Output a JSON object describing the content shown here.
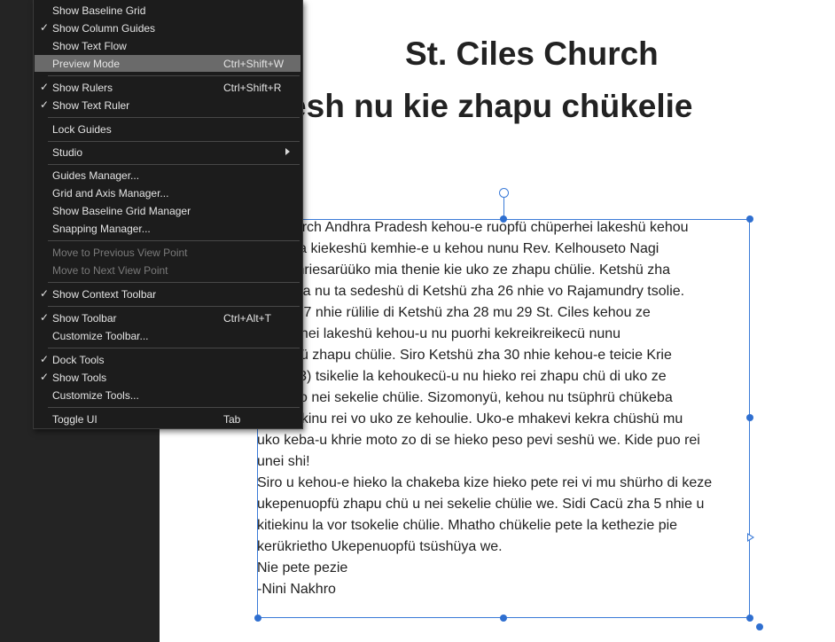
{
  "menu": {
    "items": [
      {
        "label": "Show Baseline Grid",
        "check": "",
        "shortcut": ""
      },
      {
        "label": "Show Column Guides",
        "check": "✓",
        "shortcut": ""
      },
      {
        "label": "Show Text Flow",
        "check": "",
        "shortcut": ""
      },
      {
        "label": "Preview Mode",
        "check": "",
        "shortcut": "Ctrl+Shift+W"
      },
      {
        "label": "Show Rulers",
        "check": "✓",
        "shortcut": "Ctrl+Shift+R"
      },
      {
        "label": "Show Text Ruler",
        "check": "✓",
        "shortcut": ""
      },
      {
        "label": "Lock Guides",
        "check": "",
        "shortcut": ""
      },
      {
        "label": "Studio",
        "check": "",
        "shortcut": ""
      },
      {
        "label": "Guides Manager...",
        "check": "",
        "shortcut": ""
      },
      {
        "label": "Grid and Axis Manager...",
        "check": "",
        "shortcut": ""
      },
      {
        "label": "Show Baseline Grid Manager",
        "check": "",
        "shortcut": ""
      },
      {
        "label": "Snapping Manager...",
        "check": "",
        "shortcut": ""
      },
      {
        "label": "Move to Previous View Point",
        "check": "",
        "shortcut": ""
      },
      {
        "label": "Move to Next View Point",
        "check": "",
        "shortcut": ""
      },
      {
        "label": "Show Context Toolbar",
        "check": "✓",
        "shortcut": ""
      },
      {
        "label": "Show Toolbar",
        "check": "✓",
        "shortcut": "Ctrl+Alt+T"
      },
      {
        "label": "Customize Toolbar...",
        "check": "",
        "shortcut": ""
      },
      {
        "label": "Dock Tools",
        "check": "✓",
        "shortcut": ""
      },
      {
        "label": "Show Tools",
        "check": "✓",
        "shortcut": ""
      },
      {
        "label": "Customize Tools...",
        "check": "",
        "shortcut": ""
      },
      {
        "label": "Toggle UI",
        "check": "",
        "shortcut": "Tab"
      }
    ]
  },
  "document": {
    "title": "St. Ciles Church",
    "subtitle": "hra pradesh nu kie zhapu chükelie",
    "body_lines": [
      "es Church Andhra Pradesh kehou-e ruopfü chüperhei lakeshü kehou",
      "ketuo la kiekeshü kemhie-e u kehou nunu Rev. Kelhouseto Nagi",
      ") mu khriesarüüko mia thenie  kie uko ze zhapu chülie. Ketshü zha",
      "e hakiha nu ta sedeshü di Ketshü zha 26 nhie vo Rajamundry tsolie.",
      "ü zha 27 nhie rülilie di Ketshü zha 28 mu 29 St. Ciles kehou ze",
      "chüperhei lakeshü kehou-u nu puorhi kekreikreikecü nunu",
      "enuopfü zhapu chülie. Siro Ketshü zha 30 nhie kehou-e teicie Krie",
      "Se (103) tsikelie la kehoukecü-u nu hieko rei zhapu chü di uko ze",
      "ro hieko nei sekelie chülie. Sizomonyü, kehou nu tsüphrü chükeba",
      "ro puo kinu rei vo uko ze kehoulie. Uko-e mhakevi kekra chüshü mu",
      "uko keba-u khrie moto zo di se hieko peso pevi seshü we. Kide puo rei",
      "unei shi!",
      "Siro u kehou-e hieko la chakeba kize hieko pete rei vi mu shürho di keze",
      "ukepenuopfü zhapu chü u nei sekelie chülie we. Sidi Cacü zha 5 nhie u",
      "kitiekinu la vor tsokelie chülie. Mhatho chükelie pete la kethezie pie",
      "kerükrietho Ukepenuopfü tsüshüya we.",
      "Nie pete pezie",
      "-Nini Nakhro"
    ]
  }
}
